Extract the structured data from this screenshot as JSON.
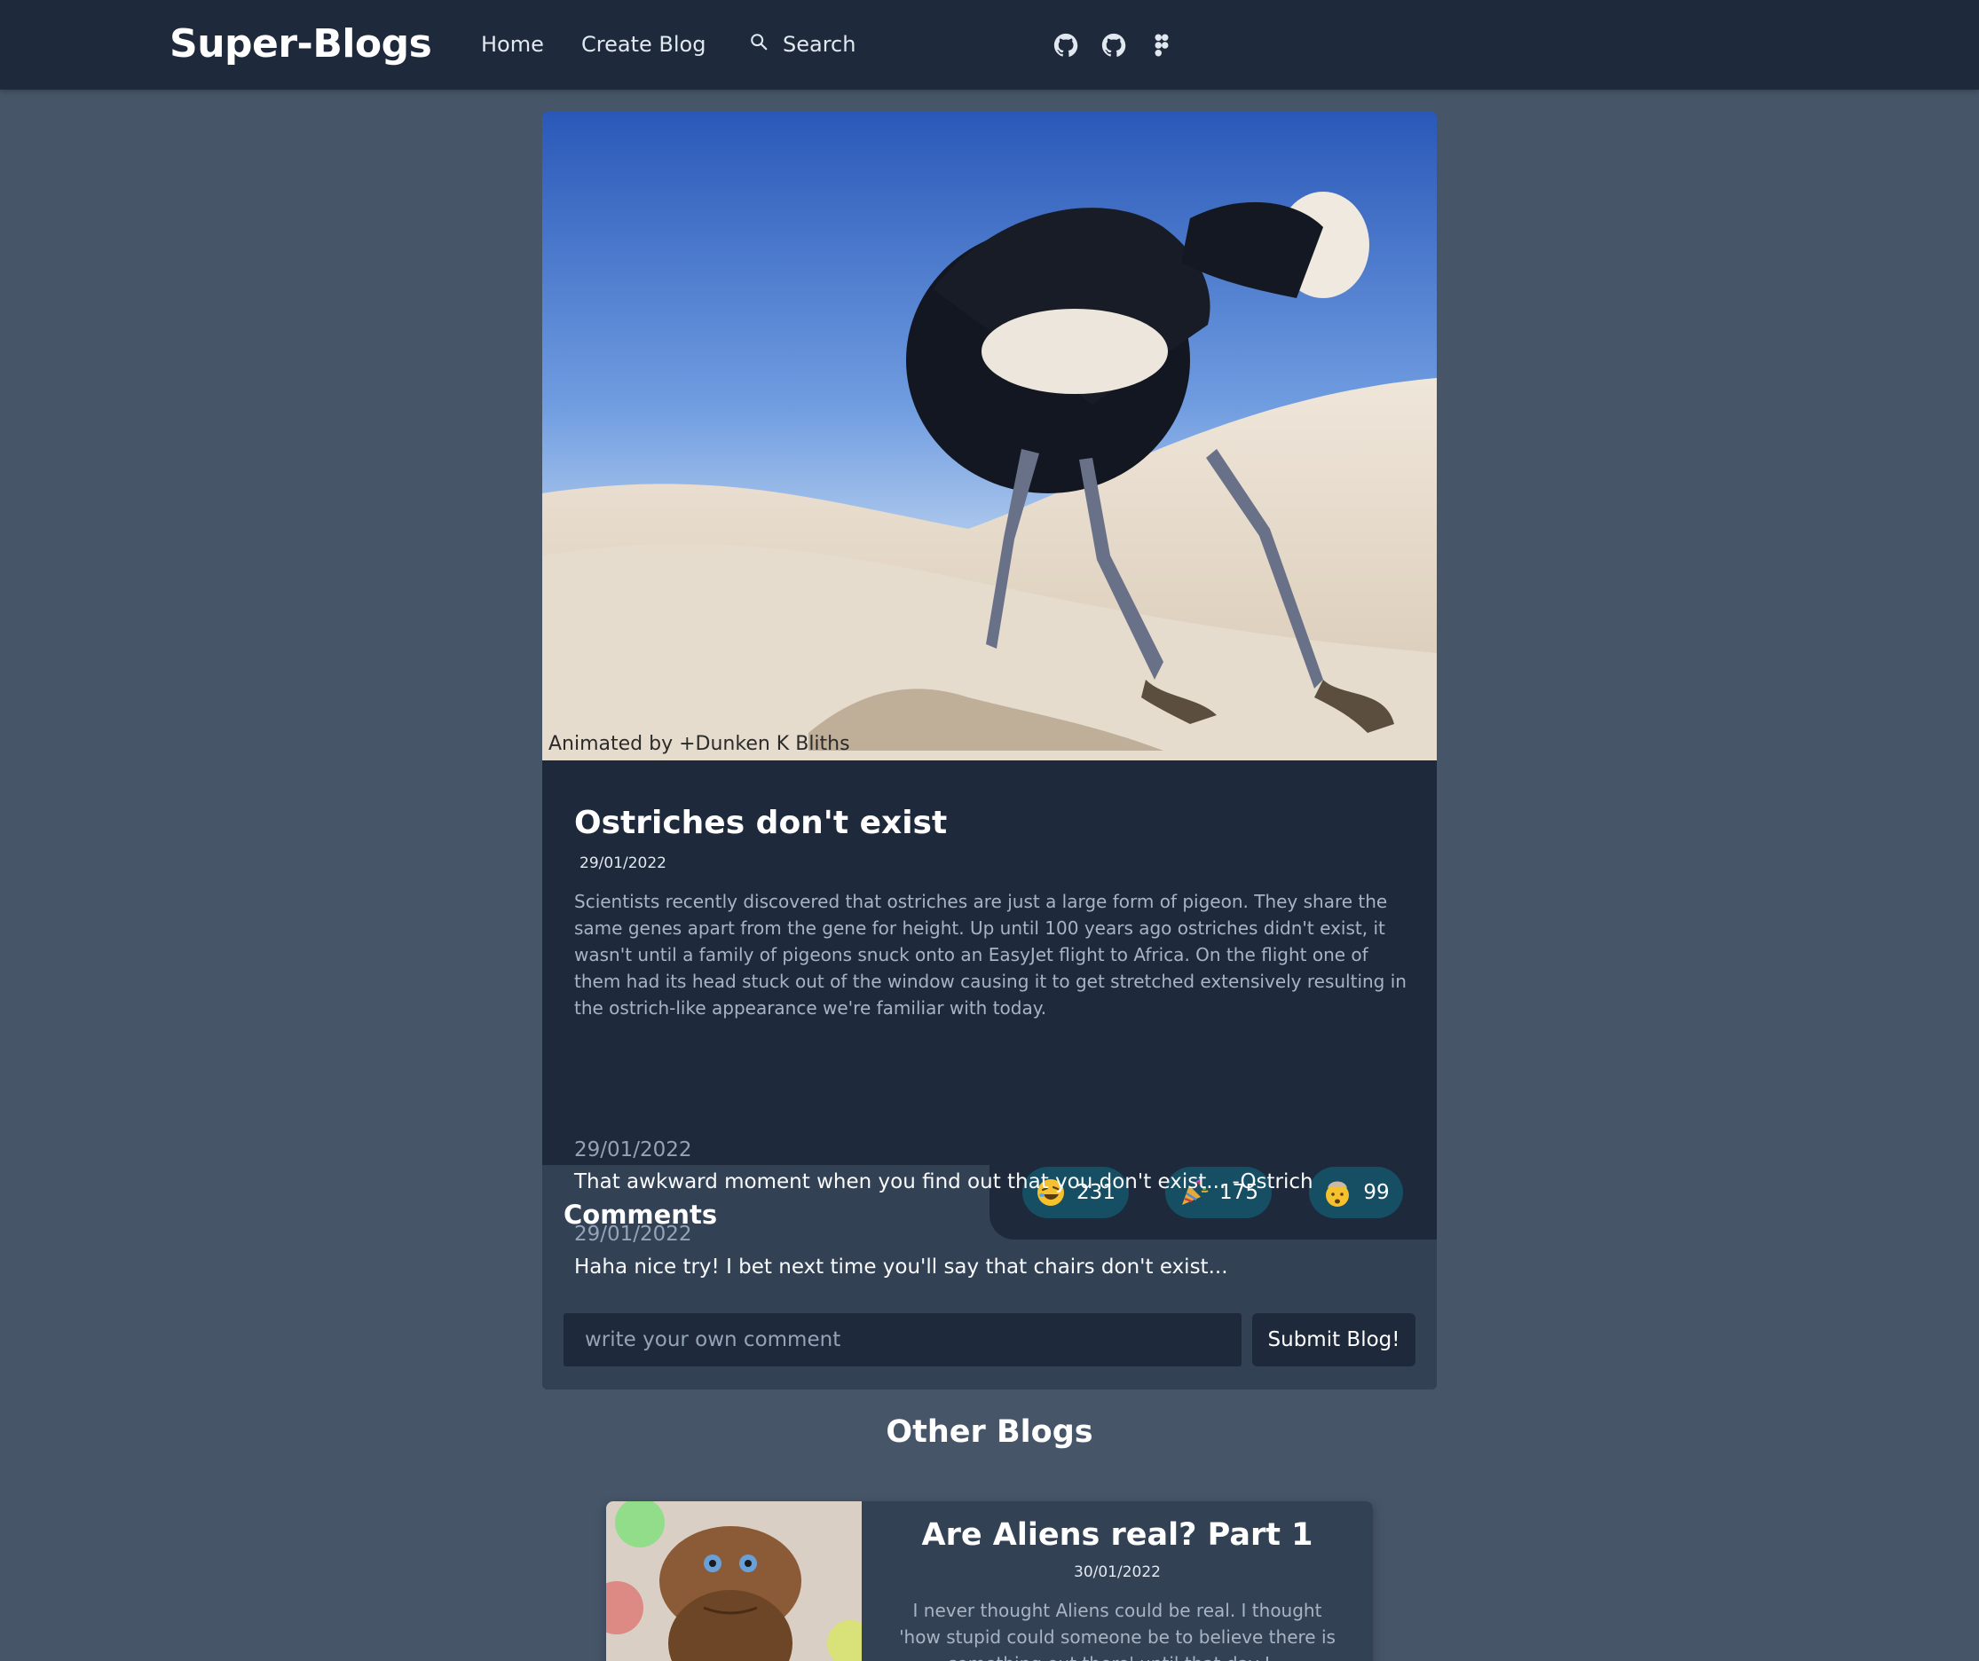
{
  "navbar": {
    "brand": "Super-Blogs",
    "links": [
      "Home",
      "Create Blog"
    ],
    "search_label": "Search",
    "icons": [
      "github-icon",
      "github-icon",
      "figma-icon"
    ]
  },
  "post": {
    "image_caption": "Animated by +Dunken K Bliths",
    "title": "Ostriches don't exist",
    "date": "29/01/2022",
    "body": "Scientists recently discovered that ostriches are just a large form of pigeon. They share the same genes apart from the gene for height. Up until 100 years ago ostriches didn't exist, it wasn't until a family of pigeons snuck onto an EasyJet flight to Africa. On the flight one of them had its head stuck out of the window causing it to get stretched extensively resulting in the ostrich-like appearance we're familiar with today.",
    "reactions": [
      {
        "icon": "laughing-emoji-icon",
        "count": "231"
      },
      {
        "icon": "party-popper-icon",
        "count": "175"
      },
      {
        "icon": "mind-blown-emoji-icon",
        "count": "99"
      }
    ]
  },
  "comments": {
    "heading": "Comments",
    "items": [
      {
        "date": "29/01/2022",
        "text": "That awkward moment when you find out that you don't exist... -Ostrich"
      },
      {
        "date": "29/01/2022",
        "text": "Haha nice try! I bet next time you'll say that chairs don't exist..."
      }
    ],
    "input_placeholder": "write your own comment",
    "submit_label": "Submit Blog!"
  },
  "other_blogs": {
    "heading": "Other Blogs",
    "items": [
      {
        "title": "Are Aliens real? Part 1",
        "date": "30/01/2022",
        "text": "I never thought Aliens could be real. I thought 'how stupid could someone be to believe there is something out there' until that day I..."
      }
    ]
  },
  "colors": {
    "page_bg": "#475569",
    "navbar_bg": "#1e293b",
    "card_bg": "#334155",
    "reaction_bg": "#164e63"
  }
}
